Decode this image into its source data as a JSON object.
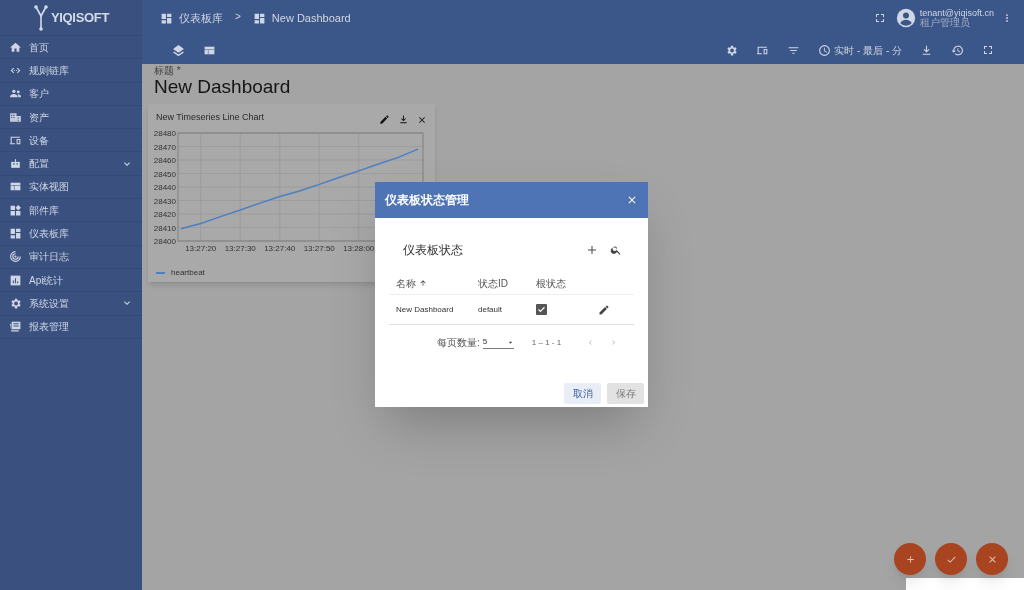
{
  "brand": {
    "name": "YIQISOFT"
  },
  "sidebar": {
    "items": [
      {
        "label": "首页",
        "kind": "link"
      },
      {
        "label": "规则链库",
        "kind": "link"
      },
      {
        "label": "客户",
        "kind": "link"
      },
      {
        "label": "资产",
        "kind": "link"
      },
      {
        "label": "设备",
        "kind": "link"
      },
      {
        "label": "配置",
        "kind": "group"
      },
      {
        "label": "实体视图",
        "kind": "link"
      },
      {
        "label": "部件库",
        "kind": "link"
      },
      {
        "label": "仪表板库",
        "kind": "link"
      },
      {
        "label": "审计日志",
        "kind": "link"
      },
      {
        "label": "Api统计",
        "kind": "link"
      },
      {
        "label": "系统设置",
        "kind": "group"
      },
      {
        "label": "报表管理",
        "kind": "link"
      }
    ]
  },
  "breadcrumb": [
    {
      "label": "仪表板库"
    },
    {
      "separator": ">"
    },
    {
      "label": "New Dashboard"
    }
  ],
  "user": {
    "email": "tenant@yiqisoft.cn",
    "role": "租户管理员"
  },
  "toolbar": {
    "timewindow": "实时 - 最后 - 分"
  },
  "dashboard": {
    "title_label": "标题 *",
    "title": "New Dashboard"
  },
  "widget": {
    "title": "New Timeseries Line Chart",
    "chart_data": {
      "type": "line",
      "categories": [
        null,
        "13:27:20",
        null,
        "13:27:30",
        null,
        "13:27:40",
        null,
        "13:27:50",
        null,
        "13:28:00",
        null,
        null,
        null
      ],
      "series": [
        {
          "name": "heartbeat",
          "color": "#4a7fc4",
          "values": [
            28409,
            28413,
            28418,
            28423,
            28428,
            28433,
            28437,
            28442,
            28447,
            28452,
            28457,
            28462,
            28468
          ]
        }
      ],
      "ylim": [
        28400,
        28480
      ],
      "grid": true,
      "yticks": [
        28400,
        28410,
        28420,
        28430,
        28440,
        28450,
        28460,
        28470,
        28480
      ]
    }
  },
  "dialog": {
    "title": "仪表板状态管理",
    "table_title": "仪表板状态",
    "columns": [
      "名称",
      "状态ID",
      "根状态"
    ],
    "rows": [
      {
        "name": "New Dashboard",
        "state_id": "default",
        "root": true
      }
    ],
    "page_size_label": "每页数量:",
    "page_size": "5",
    "range": "1 – 1 - 1",
    "buttons": [
      {
        "label": "取消",
        "disabled": false
      },
      {
        "label": "保存",
        "disabled": true
      }
    ]
  }
}
